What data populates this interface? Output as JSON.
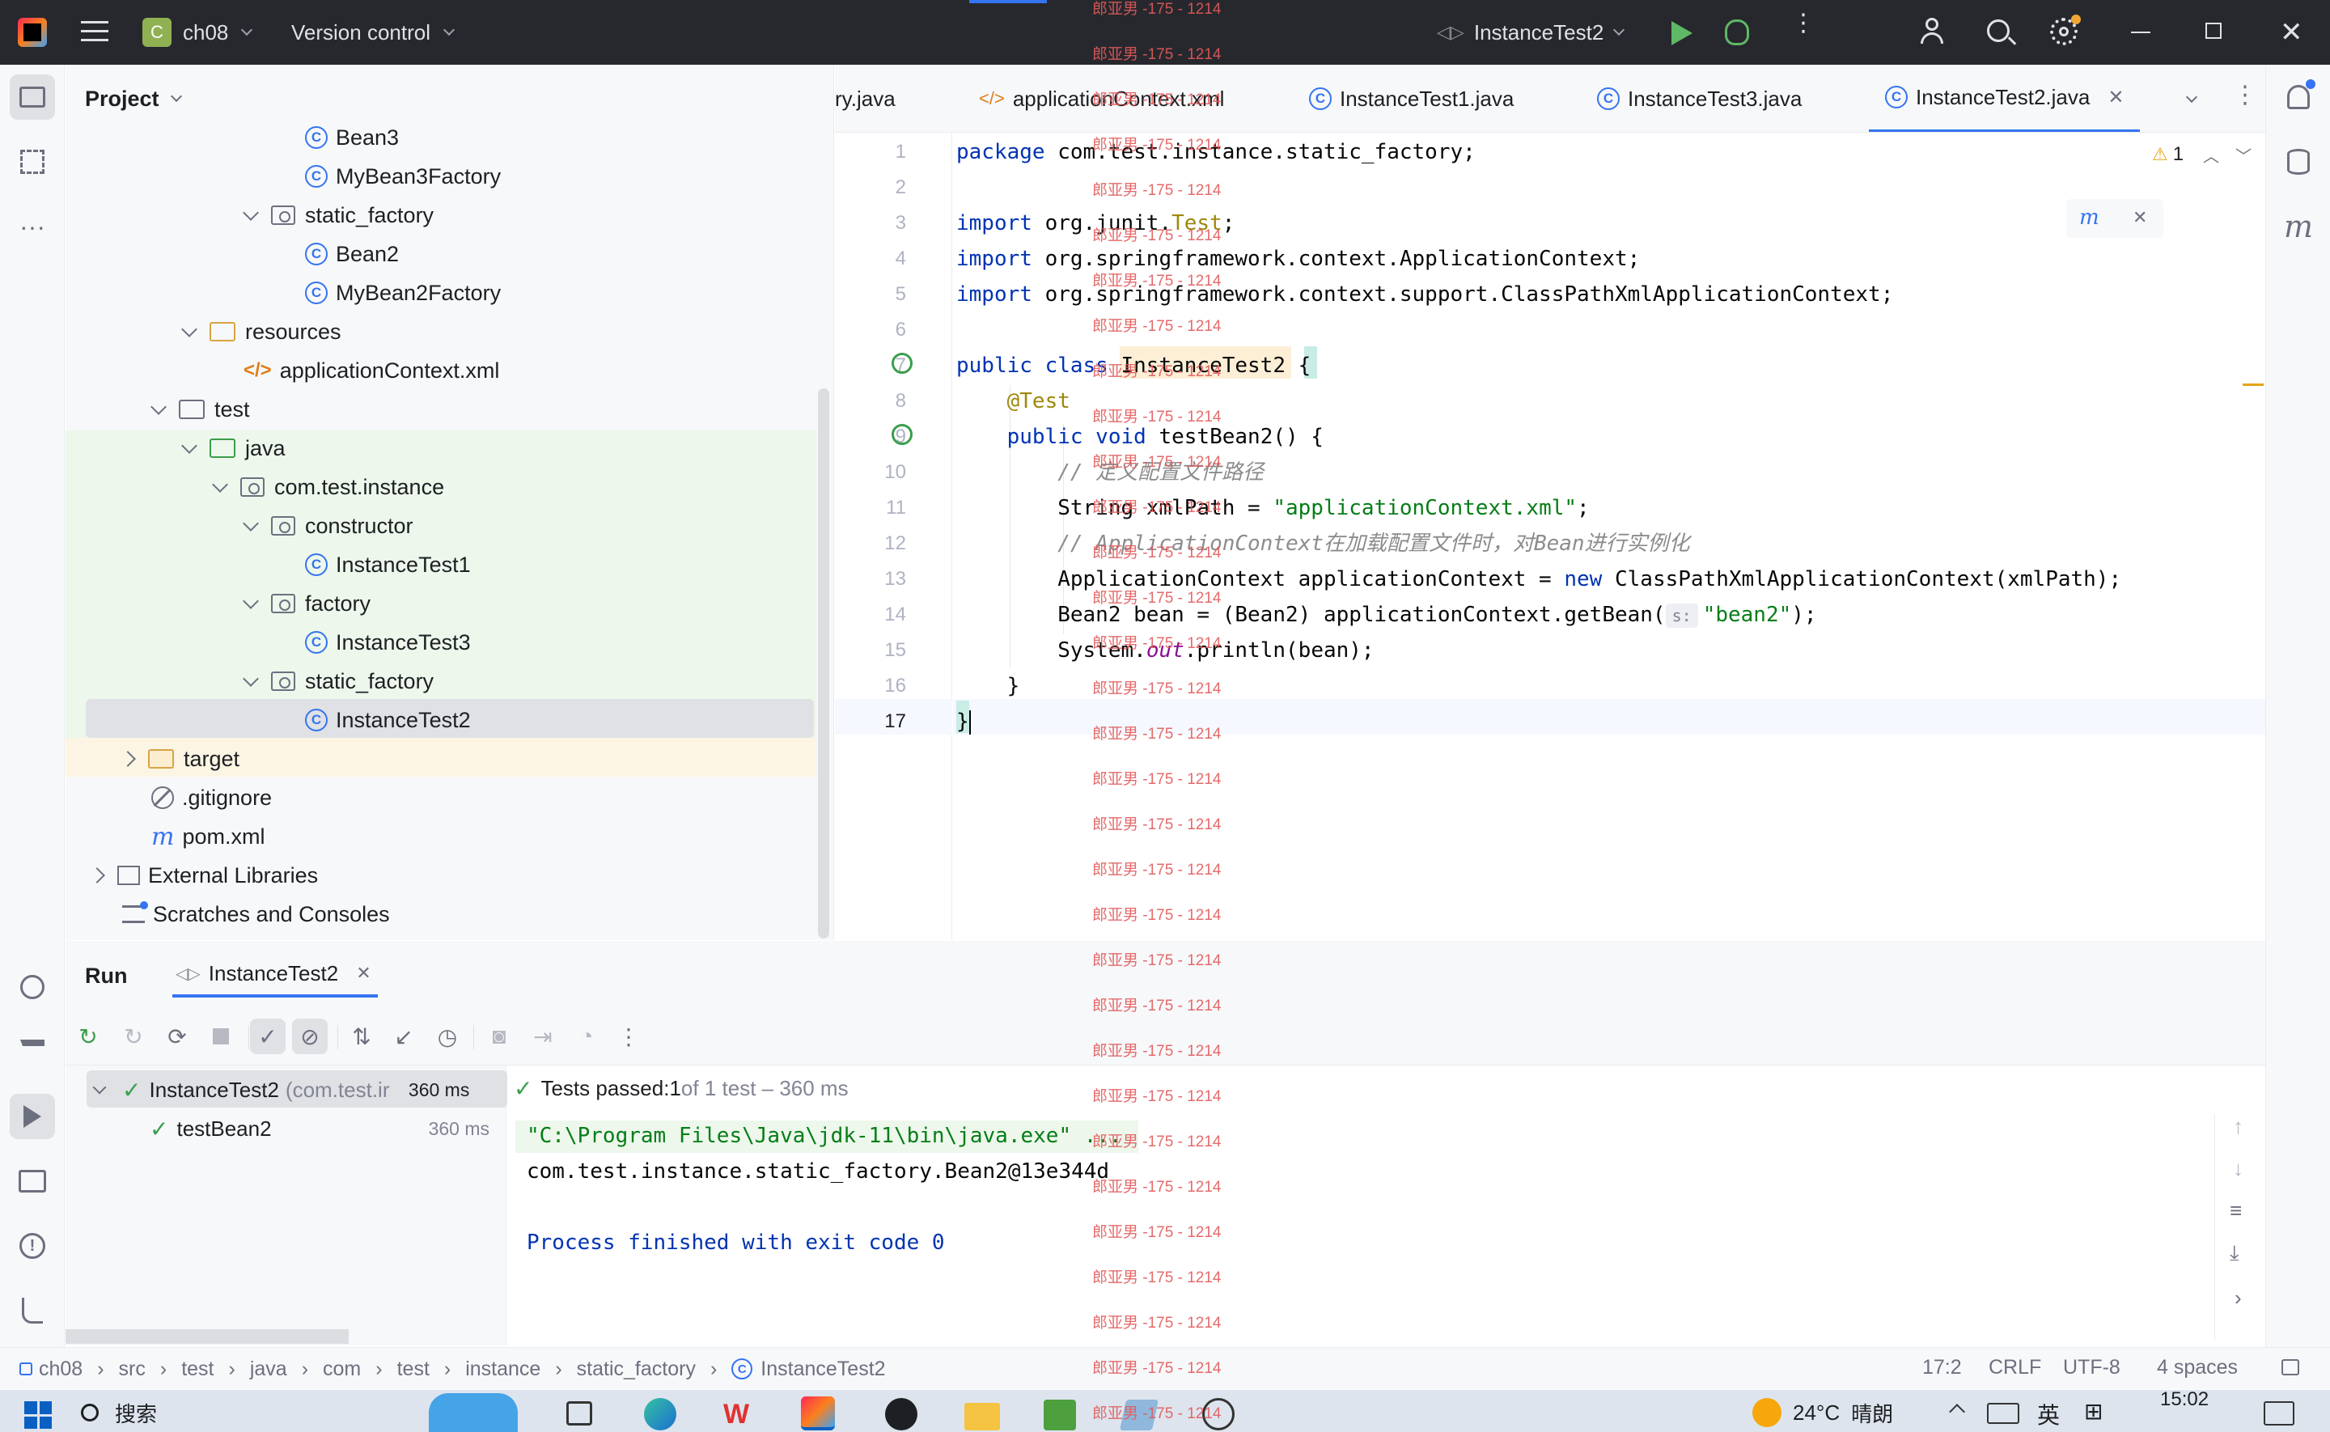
{
  "titlebar": {
    "project_badge": "C",
    "project_name": "ch08",
    "version_control": "Version control",
    "run_config": "InstanceTest2"
  },
  "project_panel": {
    "title": "Project",
    "items": [
      {
        "label": "Bean3",
        "icon": "class-icon"
      },
      {
        "label": "MyBean3Factory",
        "icon": "class-icon"
      },
      {
        "label": "static_factory",
        "icon": "package-icon"
      },
      {
        "label": "Bean2",
        "icon": "class-icon"
      },
      {
        "label": "MyBean2Factory",
        "icon": "class-icon"
      },
      {
        "label": "resources",
        "icon": "folder-icon"
      },
      {
        "label": "applicationContext.xml",
        "icon": "xml-icon"
      },
      {
        "label": "test",
        "icon": "folder-icon"
      },
      {
        "label": "java",
        "icon": "folder-icon"
      },
      {
        "label": "com.test.instance",
        "icon": "package-icon"
      },
      {
        "label": "constructor",
        "icon": "package-icon"
      },
      {
        "label": "InstanceTest1",
        "icon": "class-icon"
      },
      {
        "label": "factory",
        "icon": "package-icon"
      },
      {
        "label": "InstanceTest3",
        "icon": "class-icon"
      },
      {
        "label": "static_factory",
        "icon": "package-icon"
      },
      {
        "label": "InstanceTest2",
        "icon": "class-icon"
      },
      {
        "label": "target",
        "icon": "folder-icon"
      },
      {
        "label": ".gitignore",
        "icon": "ignore-icon"
      },
      {
        "label": "pom.xml",
        "icon": "maven-icon"
      },
      {
        "label": "External Libraries",
        "icon": "library-icon"
      },
      {
        "label": "Scratches and Consoles",
        "icon": "scratch-icon"
      }
    ]
  },
  "editor": {
    "tabs": [
      {
        "label": "ry.java"
      },
      {
        "label": "applicationContext.xml"
      },
      {
        "label": "InstanceTest1.java"
      },
      {
        "label": "InstanceTest3.java"
      },
      {
        "label": "InstanceTest2.java"
      }
    ],
    "warning_count": "1",
    "line_numbers": [
      "1",
      "2",
      "3",
      "4",
      "5",
      "6",
      "7",
      "8",
      "9",
      "10",
      "11",
      "12",
      "13",
      "14",
      "15",
      "16",
      "17"
    ],
    "code": {
      "l1_kw": "package",
      "l1_rest": " com.test.instance.static_factory;",
      "l3_kw": "import",
      "l3_a": " org.junit.",
      "l3_b": "Test",
      "l3_c": ";",
      "l4_kw": "import",
      "l4_rest": " org.springframework.context.ApplicationContext;",
      "l5_kw": "import",
      "l5_rest": " org.springframework.context.support.ClassPathXmlApplicationContext;",
      "l7_kw": "public class",
      "l7_name": " InstanceTest2",
      "l7_brace": " {",
      "l8_ann": "    @Test",
      "l9_kw": "    public void",
      "l9_rest": " testBean2() {",
      "l10_cmt": "        // 定义配置文件路径",
      "l11_a": "        String xmlPath = ",
      "l11_str": "\"applicationContext.xml\"",
      "l11_c": ";",
      "l12_cmt": "        // ApplicationContext在加载配置文件时，对Bean进行实例化",
      "l13_a": "        ApplicationContext applicationContext = ",
      "l13_kw": "new",
      "l13_b": " ClassPathXmlApplicationContext(xmlPath);",
      "l14_a": "        Bean2 bean = (Bean2) applicationContext.getBean(",
      "l14_hint": "s:",
      "l14_str": "\"bean2\"",
      "l14_c": ");",
      "l15_a": "        System.",
      "l15_fld": "out",
      "l15_b": ".println(bean);",
      "l16": "    }",
      "l17": "}"
    }
  },
  "run": {
    "tab_run": "Run",
    "tab_config": "InstanceTest2",
    "tree": {
      "root_label": "InstanceTest2",
      "root_pkg": "(com.test.ir",
      "root_time": "360 ms",
      "child_label": "testBean2",
      "child_time": "360 ms"
    },
    "summary_a": "Tests passed: ",
    "summary_b": "1",
    "summary_c": " of 1 test – 360 ms",
    "console": {
      "line1": "\"C:\\Program Files\\Java\\jdk-11\\bin\\java.exe\" ...",
      "line2": "com.test.instance.static_factory.Bean2@13e344d",
      "line4": "Process finished with exit code 0"
    }
  },
  "statusbar": {
    "breadcrumbs": [
      "ch08",
      "src",
      "test",
      "java",
      "com",
      "test",
      "instance",
      "static_factory",
      "InstanceTest2"
    ],
    "position": "17:2",
    "line_ending": "CRLF",
    "encoding": "UTF-8",
    "indent": "4 spaces"
  },
  "taskbar": {
    "search": "搜索",
    "weather_temp": "24°C",
    "weather_text": "晴朗",
    "ime": "英",
    "time": "15:02"
  },
  "watermark": "郎亚男 -175 - 1214",
  "colors": {
    "accent": "#3574f0",
    "test_pass": "#3a9e4b",
    "title_bg": "#27282e"
  }
}
